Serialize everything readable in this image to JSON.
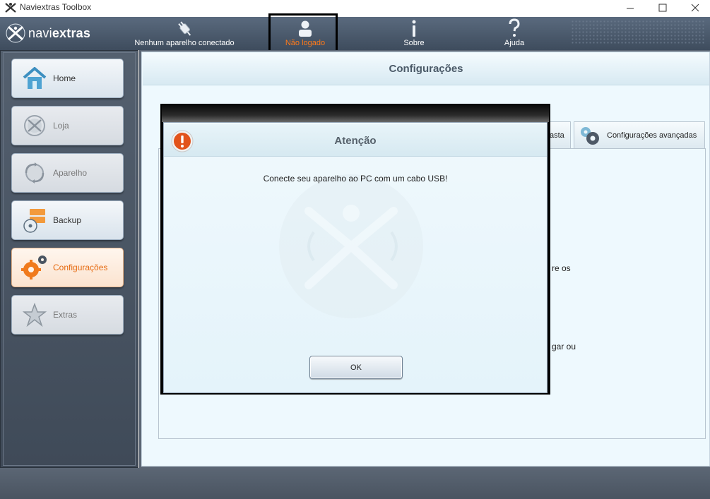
{
  "window": {
    "title": "Naviextras Toolbox"
  },
  "logo": {
    "brand_light": "navi",
    "brand_bold": "extras"
  },
  "topnav": {
    "device": "Nenhum aparelho conectado",
    "user": "Não logado",
    "about": "Sobre",
    "help": "Ajuda"
  },
  "sidebar": {
    "items": [
      {
        "label": "Home",
        "state": "normal"
      },
      {
        "label": "Loja",
        "state": "disabled"
      },
      {
        "label": "Aparelho",
        "state": "disabled"
      },
      {
        "label": "Backup",
        "state": "normal"
      },
      {
        "label": "Configurações",
        "state": "active"
      },
      {
        "label": "Extras",
        "state": "disabled"
      }
    ]
  },
  "main": {
    "title": "Configurações",
    "tabs": [
      {
        "label": "asta"
      },
      {
        "label": "Configurações avançadas"
      }
    ],
    "bg_text": [
      "re os",
      "gar ou"
    ]
  },
  "dialog": {
    "title": "Atenção",
    "message": "Conecte seu aparelho ao PC com um cabo USB!",
    "ok_label": "OK"
  },
  "colors": {
    "accent_orange": "#e66a10",
    "nav_bg": "#4a5868",
    "panel_bg": "#eef9fe"
  }
}
